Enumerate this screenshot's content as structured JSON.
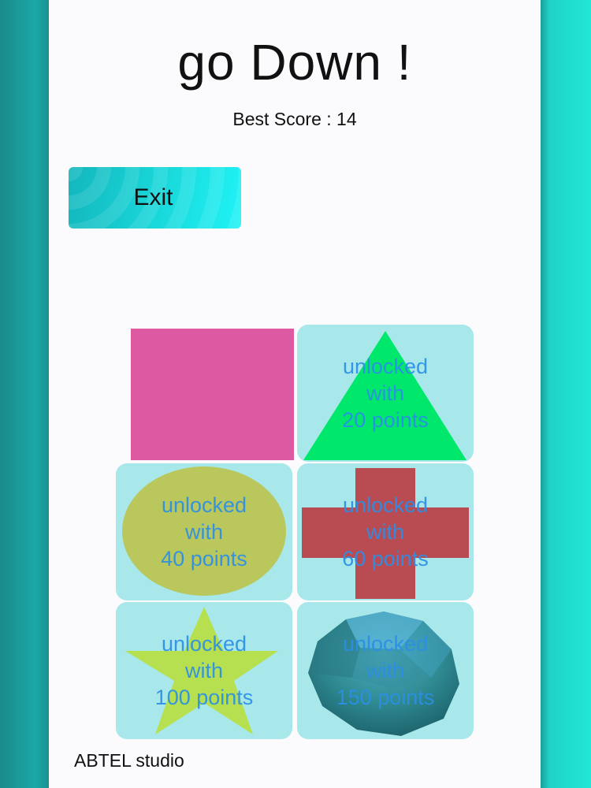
{
  "title": "go Down !",
  "best_score_text": "Best Score : 14",
  "exit_label": "Exit",
  "footer": "ABTEL studio",
  "shapes": [
    {
      "name": "square",
      "color": "#dd5aa3",
      "locked": false
    },
    {
      "name": "triangle",
      "color": "#00e86b",
      "locked": true,
      "lines": [
        "unlocked",
        "with",
        "20 points"
      ]
    },
    {
      "name": "circle",
      "color": "#b9c75c",
      "locked": true,
      "lines": [
        "unlocked",
        "with",
        "40 points"
      ]
    },
    {
      "name": "cross",
      "color": "#b84c52",
      "locked": true,
      "lines": [
        "unlocked",
        "with",
        "60 points"
      ]
    },
    {
      "name": "star",
      "color": "#b6e04f",
      "locked": true,
      "lines": [
        "unlocked",
        "with",
        "100 points"
      ]
    },
    {
      "name": "sphere",
      "color": "#2f8a92",
      "locked": true,
      "lines": [
        "unlocked",
        "with",
        "150 points"
      ]
    }
  ]
}
